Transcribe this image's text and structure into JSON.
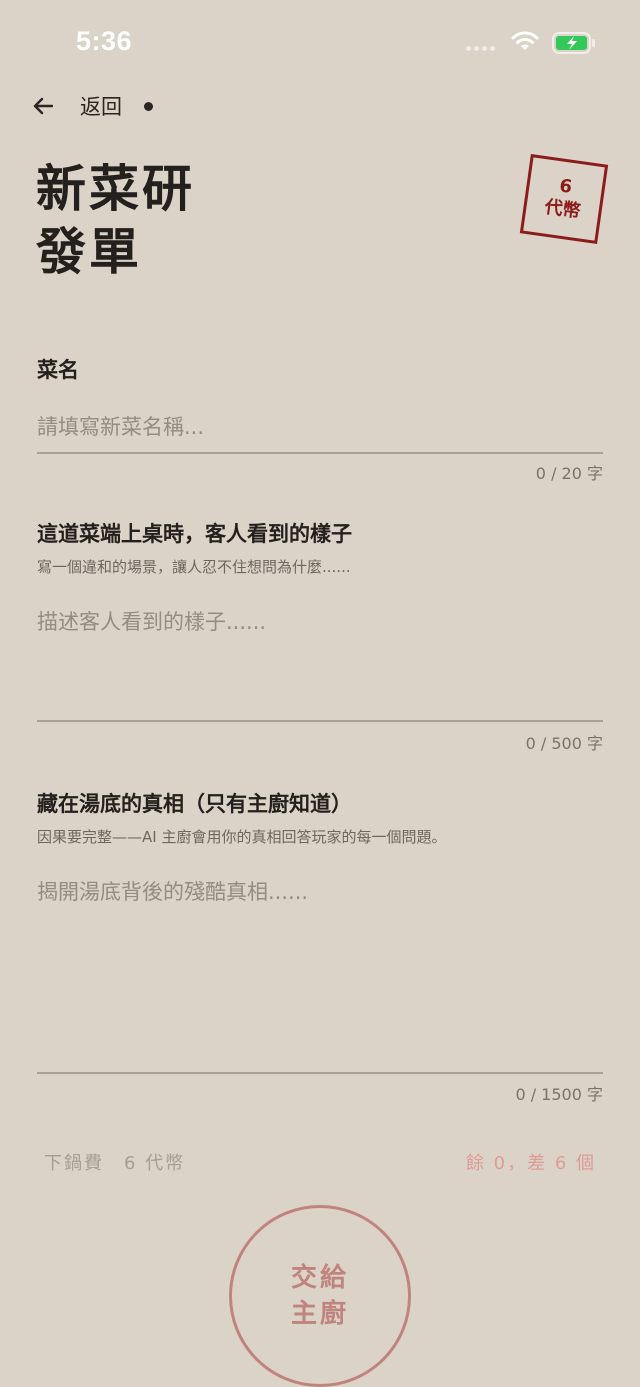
{
  "status_bar": {
    "time": "5:36",
    "icons": [
      "signal-icon",
      "wifi-icon",
      "battery-charging-icon"
    ]
  },
  "nav": {
    "back_icon": "back-arrow-icon",
    "back_label": "返回"
  },
  "title": {
    "line1": "新菜研",
    "line2": "發單"
  },
  "stamp": {
    "count": "6",
    "unit": "代幣",
    "color": "#8c1c1c"
  },
  "fields": {
    "dish_name": {
      "label": "菜名",
      "placeholder": "請填寫新菜名稱...",
      "value": "",
      "counter": "0 / 20 字"
    },
    "surface": {
      "label": "這道菜端上桌時，客人看到的樣子",
      "hint": "寫一個違和的場景，讓人忍不住想問為什麼......",
      "placeholder": "描述客人看到的樣子......",
      "value": "",
      "counter": "0 / 500 字"
    },
    "truth": {
      "label": "藏在湯底的真相（只有主廚知道）",
      "hint": "因果要完整——AI 主廚會用你的真相回答玩家的每一個問題。",
      "placeholder": "揭開湯底背後的殘酷真相......",
      "value": "",
      "counter": "0 / 1500 字"
    }
  },
  "footer": {
    "fee_label": "下鍋費　6 代幣",
    "balance_label": "餘 0，差 6 個",
    "balance_color": "#df9b98"
  },
  "submit": {
    "label": "交給主廚",
    "color": "#c0847f"
  },
  "colors": {
    "background": "#dbd3c7",
    "text": "#2a2622"
  }
}
